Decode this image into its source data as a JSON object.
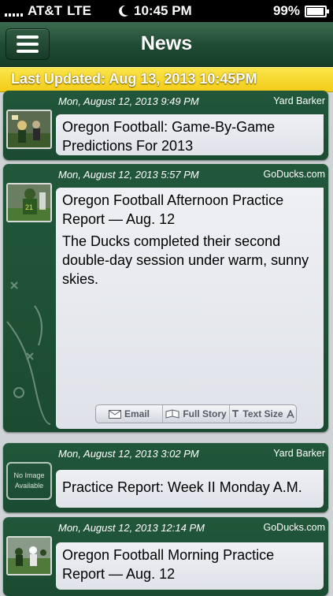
{
  "status_bar": {
    "carrier": "AT&T",
    "network": "LTE",
    "time": "10:45 PM",
    "battery": "99%"
  },
  "navbar": {
    "title": "News",
    "menu_icon": "hamburger-icon"
  },
  "last_updated": "Last Updated: Aug 13, 2013 10:45PM",
  "articles": [
    {
      "date": "Mon, August 12, 2013 9:49 PM",
      "source": "Yard Barker",
      "headline": "Oregon Football: Game-By-Game Predictions For 2013",
      "summary": "",
      "thumbnail": "photo"
    },
    {
      "date": "Mon, August 12, 2013 5:57 PM",
      "source": "GoDucks.com",
      "headline": "Oregon Football Afternoon Practice Report — Aug. 12",
      "summary": "The Ducks completed their second double-day session under warm, sunny skies.",
      "thumbnail": "photo",
      "actions": {
        "email": "Email",
        "full_story": "Full Story",
        "text_size": "Text Size"
      }
    },
    {
      "date": "Mon, August 12, 2013 3:02 PM",
      "source": "Yard Barker",
      "headline": "Practice Report: Week II Monday A.M.",
      "summary": "",
      "thumbnail": "none",
      "no_image_label": "No Image Available"
    },
    {
      "date": "Mon, August 12, 2013 12:14 PM",
      "source": "GoDucks.com",
      "headline": "Oregon Football Morning Practice Report — Aug. 12",
      "summary": "",
      "thumbnail": "photo"
    }
  ],
  "colors": {
    "nav_green": "#1f4a32",
    "card_green": "#1b4b31",
    "updated_yellow": "#f3cc18"
  }
}
